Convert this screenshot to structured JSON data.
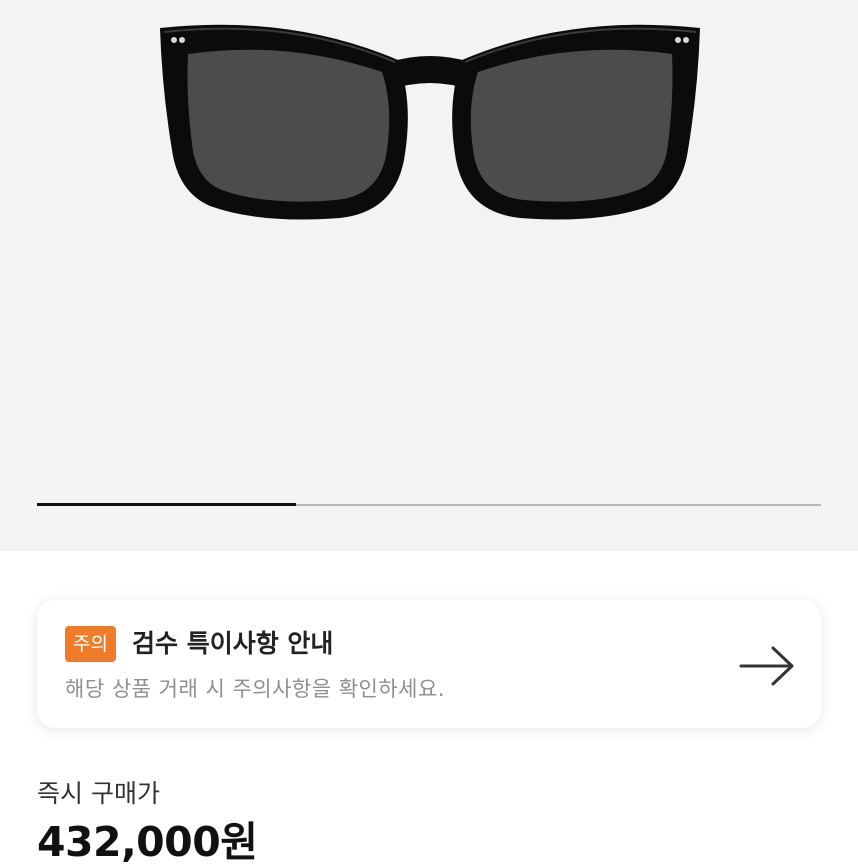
{
  "product": {
    "image_icon": "sunglasses-image",
    "gallery_progress": 0.33
  },
  "notice": {
    "badge": "주의",
    "title": "검수 특이사항 안내",
    "subtitle": "해당 상품 거래 시 주의사항을 확인하세요.",
    "arrow_icon": "arrow-right-icon",
    "badge_color": "#f07c2a"
  },
  "purchase": {
    "label": "즉시 구매가",
    "price": "432,000원"
  }
}
